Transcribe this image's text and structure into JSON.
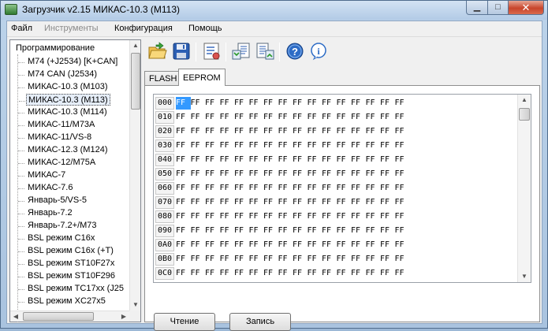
{
  "window": {
    "title": "Загрузчик v2.15 МИКАС-10.3 (M113)"
  },
  "menu": [
    {
      "label": "Файл",
      "enabled": true
    },
    {
      "label": "Инструменты",
      "enabled": false
    },
    {
      "label": "Конфигурация",
      "enabled": true
    },
    {
      "label": "Помощь",
      "enabled": true
    }
  ],
  "tree": {
    "root": "Программирование",
    "items": [
      "M74 (+J2534) [K+CAN]",
      "M74 CAN (J2534)",
      "МИКАС-10.3 (M103)",
      "МИКАС-10.3 (M113)",
      "МИКАС-10.3 (M114)",
      "МИКАС-11/M73A",
      "МИКАС-11/VS-8",
      "МИКАС-12.3 (M124)",
      "МИКАС-12/M75A",
      "МИКАС-7",
      "МИКАС-7.6",
      "Январь-5/VS-5",
      "Январь-7.2",
      "Январь-7.2+/M73",
      "BSL режим C16x",
      "BSL режим C16x (+T)",
      "BSL режим ST10F27x",
      "BSL режим ST10F296",
      "BSL режим TC17xx (J25",
      "BSL режим XC27x5"
    ],
    "selected_index": 3
  },
  "toolbar": {
    "buttons": [
      "open-folder-icon",
      "save-disk-icon",
      "settings-checklist-icon",
      "read-ecu-icon",
      "write-ecu-icon",
      "help-icon",
      "info-icon"
    ]
  },
  "tabs": [
    {
      "label": "FLASH",
      "active": false
    },
    {
      "label": "EEPROM",
      "active": true
    }
  ],
  "hex": {
    "rows": [
      {
        "addr": "000",
        "bytes": [
          "FF",
          "FF",
          "FF",
          "FF",
          "FF",
          "FF",
          "FF",
          "FF",
          "FF",
          "FF",
          "FF",
          "FF",
          "FF",
          "FF",
          "FF",
          "FF"
        ]
      },
      {
        "addr": "010",
        "bytes": [
          "FF",
          "FF",
          "FF",
          "FF",
          "FF",
          "FF",
          "FF",
          "FF",
          "FF",
          "FF",
          "FF",
          "FF",
          "FF",
          "FF",
          "FF",
          "FF"
        ]
      },
      {
        "addr": "020",
        "bytes": [
          "FF",
          "FF",
          "FF",
          "FF",
          "FF",
          "FF",
          "FF",
          "FF",
          "FF",
          "FF",
          "FF",
          "FF",
          "FF",
          "FF",
          "FF",
          "FF"
        ]
      },
      {
        "addr": "030",
        "bytes": [
          "FF",
          "FF",
          "FF",
          "FF",
          "FF",
          "FF",
          "FF",
          "FF",
          "FF",
          "FF",
          "FF",
          "FF",
          "FF",
          "FF",
          "FF",
          "FF"
        ]
      },
      {
        "addr": "040",
        "bytes": [
          "FF",
          "FF",
          "FF",
          "FF",
          "FF",
          "FF",
          "FF",
          "FF",
          "FF",
          "FF",
          "FF",
          "FF",
          "FF",
          "FF",
          "FF",
          "FF"
        ]
      },
      {
        "addr": "050",
        "bytes": [
          "FF",
          "FF",
          "FF",
          "FF",
          "FF",
          "FF",
          "FF",
          "FF",
          "FF",
          "FF",
          "FF",
          "FF",
          "FF",
          "FF",
          "FF",
          "FF"
        ]
      },
      {
        "addr": "060",
        "bytes": [
          "FF",
          "FF",
          "FF",
          "FF",
          "FF",
          "FF",
          "FF",
          "FF",
          "FF",
          "FF",
          "FF",
          "FF",
          "FF",
          "FF",
          "FF",
          "FF"
        ]
      },
      {
        "addr": "070",
        "bytes": [
          "FF",
          "FF",
          "FF",
          "FF",
          "FF",
          "FF",
          "FF",
          "FF",
          "FF",
          "FF",
          "FF",
          "FF",
          "FF",
          "FF",
          "FF",
          "FF"
        ]
      },
      {
        "addr": "080",
        "bytes": [
          "FF",
          "FF",
          "FF",
          "FF",
          "FF",
          "FF",
          "FF",
          "FF",
          "FF",
          "FF",
          "FF",
          "FF",
          "FF",
          "FF",
          "FF",
          "FF"
        ]
      },
      {
        "addr": "090",
        "bytes": [
          "FF",
          "FF",
          "FF",
          "FF",
          "FF",
          "FF",
          "FF",
          "FF",
          "FF",
          "FF",
          "FF",
          "FF",
          "FF",
          "FF",
          "FF",
          "FF"
        ]
      },
      {
        "addr": "0A0",
        "bytes": [
          "FF",
          "FF",
          "FF",
          "FF",
          "FF",
          "FF",
          "FF",
          "FF",
          "FF",
          "FF",
          "FF",
          "FF",
          "FF",
          "FF",
          "FF",
          "FF"
        ]
      },
      {
        "addr": "0B0",
        "bytes": [
          "FF",
          "FF",
          "FF",
          "FF",
          "FF",
          "FF",
          "FF",
          "FF",
          "FF",
          "FF",
          "FF",
          "FF",
          "FF",
          "FF",
          "FF",
          "FF"
        ]
      },
      {
        "addr": "0C0",
        "bytes": [
          "FF",
          "FF",
          "FF",
          "FF",
          "FF",
          "FF",
          "FF",
          "FF",
          "FF",
          "FF",
          "FF",
          "FF",
          "FF",
          "FF",
          "FF",
          "FF"
        ]
      }
    ],
    "selected_cell": [
      0,
      0
    ],
    "selection_color": "#3399ff"
  },
  "buttons": {
    "read_label": "Чтение",
    "write_label": "Запись"
  }
}
